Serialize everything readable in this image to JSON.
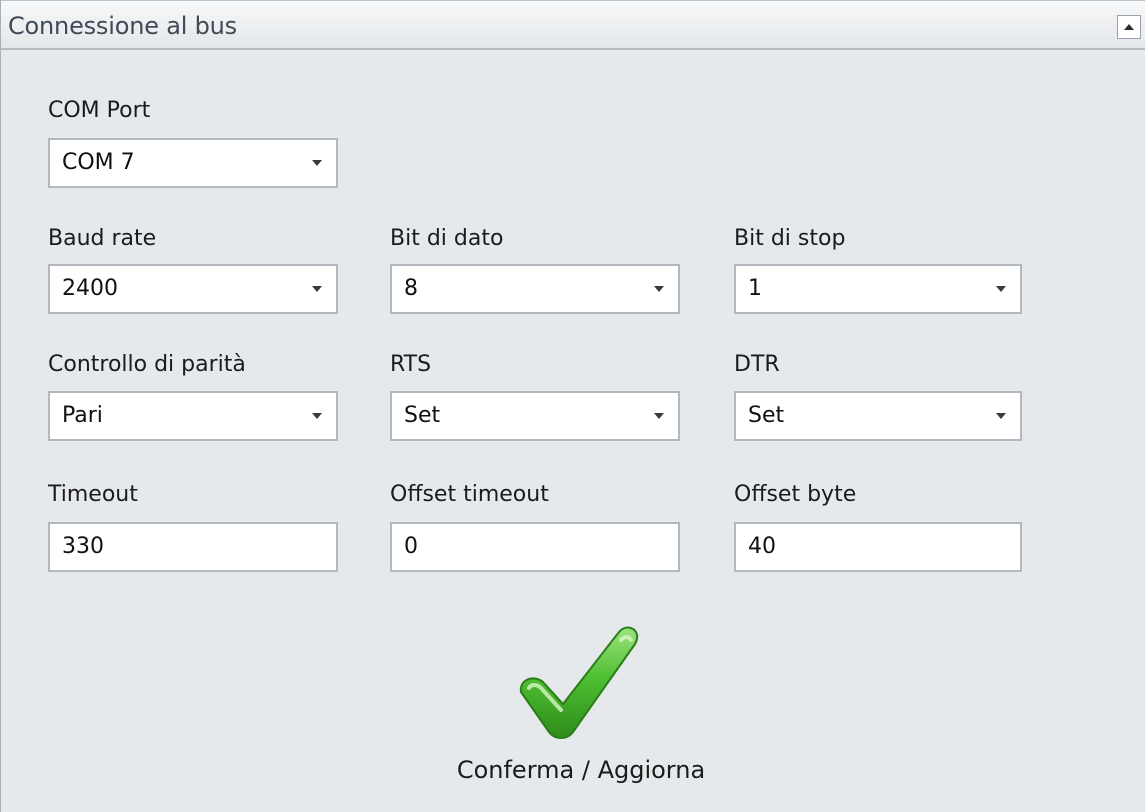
{
  "panel": {
    "title": "Connessione al bus",
    "collapse_icon": "chevron-up-icon"
  },
  "fields": {
    "com_port": {
      "label": "COM Port",
      "value": "COM 7"
    },
    "baud_rate": {
      "label": "Baud rate",
      "value": "2400"
    },
    "data_bits": {
      "label": "Bit di dato",
      "value": "8"
    },
    "stop_bits": {
      "label": "Bit di stop",
      "value": "1"
    },
    "parity": {
      "label": "Controllo di parità",
      "value": "Pari"
    },
    "rts": {
      "label": "RTS",
      "value": "Set"
    },
    "dtr": {
      "label": "DTR",
      "value": "Set"
    },
    "timeout": {
      "label": "Timeout",
      "value": "330"
    },
    "offset_timeout": {
      "label": "Offset timeout",
      "value": "0"
    },
    "offset_byte": {
      "label": "Offset byte",
      "value": "40"
    }
  },
  "confirm": {
    "label": "Conferma / Aggiorna",
    "icon": "checkmark-icon",
    "icon_color": "#3fae2a"
  },
  "colors": {
    "background": "#e6e9ec",
    "field_border": "#b3b8be",
    "header_text": "#3f4a57"
  }
}
